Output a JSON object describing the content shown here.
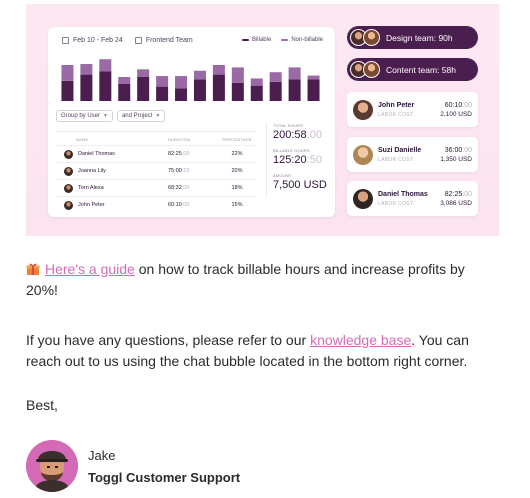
{
  "report": {
    "date_range": "Feb 10 - Feb 24",
    "project_filter": "Frontend Team",
    "legend_billable": "Billable",
    "legend_nonbillable": "Non-billable",
    "color_billable": "#4a1f4f",
    "color_nonbillable": "#9b6aa6",
    "group_by": "Group by User",
    "and_project": "and Project",
    "bars": [
      {
        "billable": 0.42,
        "nonbillable": 0.33
      },
      {
        "billable": 0.55,
        "nonbillable": 0.22
      },
      {
        "billable": 0.62,
        "nonbillable": 0.25
      },
      {
        "billable": 0.36,
        "nonbillable": 0.14
      },
      {
        "billable": 0.5,
        "nonbillable": 0.16
      },
      {
        "billable": 0.3,
        "nonbillable": 0.22
      },
      {
        "billable": 0.26,
        "nonbillable": 0.26
      },
      {
        "billable": 0.45,
        "nonbillable": 0.18
      },
      {
        "billable": 0.55,
        "nonbillable": 0.2
      },
      {
        "billable": 0.38,
        "nonbillable": 0.32
      },
      {
        "billable": 0.32,
        "nonbillable": 0.15
      },
      {
        "billable": 0.4,
        "nonbillable": 0.2
      },
      {
        "billable": 0.45,
        "nonbillable": 0.25
      },
      {
        "billable": 0.45,
        "nonbillable": 0.08
      }
    ],
    "table_headers": {
      "name": "NAME",
      "duration": "DURATION",
      "percentage": "PERCENTAGE"
    },
    "rows": [
      {
        "name": "Daniel Thomas",
        "duration": "82:25",
        "duration_dim": ":00",
        "percentage": "22%"
      },
      {
        "name": "Joanna Lily",
        "duration": "75:00",
        "duration_dim": ":15",
        "percentage": "20%"
      },
      {
        "name": "Torri Alexa",
        "duration": "68:32",
        "duration_dim": ":00",
        "percentage": "18%"
      },
      {
        "name": "John Peter",
        "duration": "60:10",
        "duration_dim": ":00",
        "percentage": "15%"
      }
    ],
    "totals": {
      "total_label": "TOTAL HOURS",
      "total_value": "200:58",
      "total_dim": ":00",
      "billable_label": "BILLABLE HOURS",
      "billable_value": "125:20",
      "billable_dim": ":50",
      "amount_label": "AMOUNT",
      "amount_value": "7,500 USD"
    }
  },
  "teams": [
    {
      "label": "Design team: 90h"
    },
    {
      "label": "Content team: 58h"
    }
  ],
  "people": [
    {
      "name": "John Peter",
      "time": "60:10",
      "time_dim": ":00",
      "cost_label": "LABOR COST:",
      "cost": "2,100 USD"
    },
    {
      "name": "Suzi Danielle",
      "time": "36:00",
      "time_dim": ":00",
      "cost_label": "LABOR COST:",
      "cost": "1,350 USD"
    },
    {
      "name": "Daniel Thomas",
      "time": "82:25",
      "time_dim": ":00",
      "cost_label": "LABOR COST:",
      "cost": "3,086 USD"
    }
  ],
  "email": {
    "guide_link": "Here's a guide",
    "guide_rest": " on how to track billable hours and increase profits by 20%!",
    "questions_pre": "If you have any questions, please refer to our ",
    "kb_link": "knowledge base",
    "questions_post": ". You can reach out to us using the chat bubble located in the bottom right corner.",
    "sign_off": "Best,",
    "sender_name": "Jake",
    "sender_role": "Toggl Customer Support"
  }
}
